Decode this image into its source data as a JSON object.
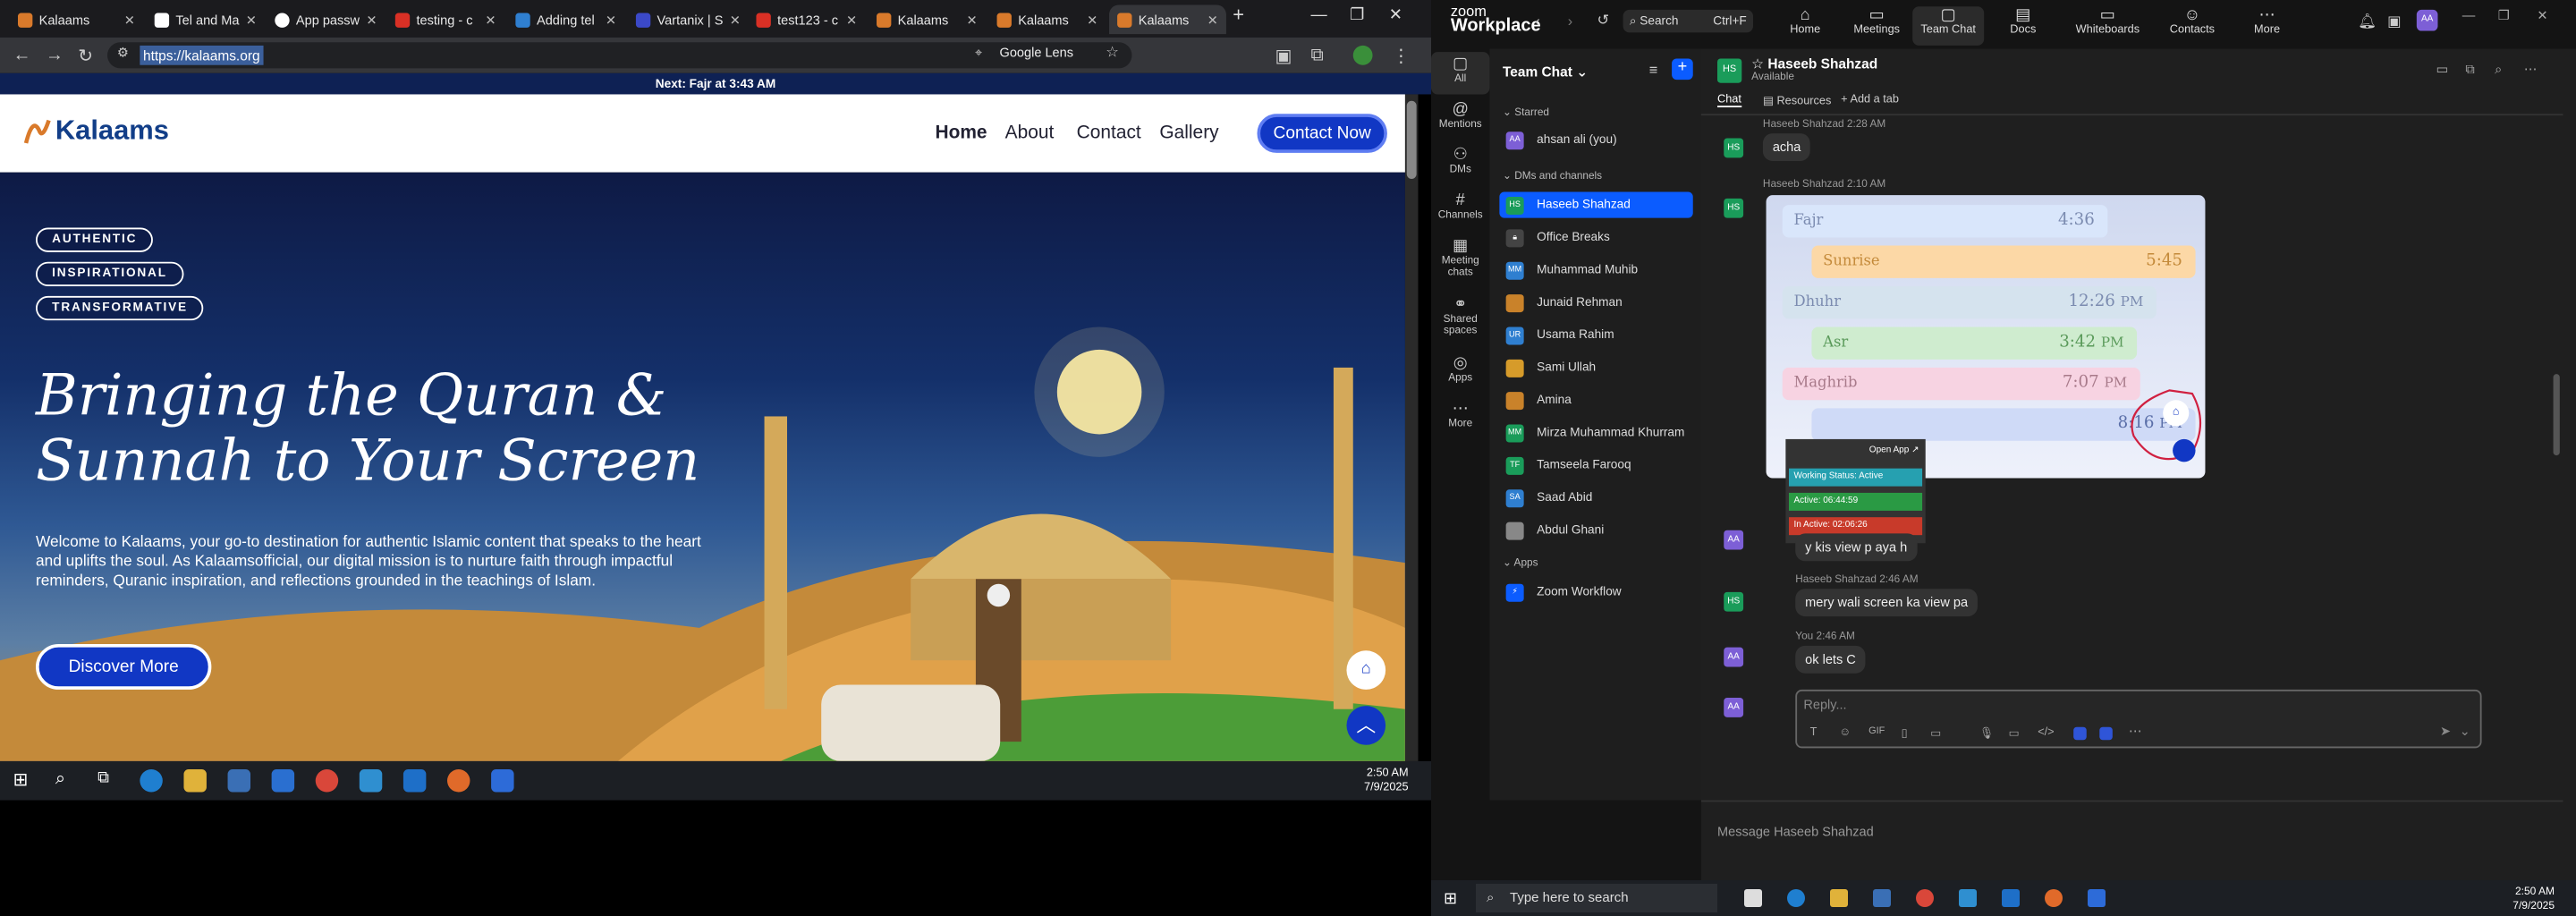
{
  "browser": {
    "tabs": [
      "Kalaams",
      "Tel and Ma",
      "App passw",
      "testing - c",
      "Adding tel",
      "Vartanix | S",
      "test123 - c",
      "Kalaams",
      "Kalaams",
      "Kalaams"
    ],
    "url": "https://kalaams.org",
    "lens_label": "Google Lens"
  },
  "site": {
    "notice": "Next: Fajr at 3:43 AM",
    "logo": "Kalaams",
    "nav": [
      "Home",
      "About",
      "Contact",
      "Gallery"
    ],
    "cta": "Contact Now",
    "pills": [
      "AUTHENTIC",
      "INSPIRATIONAL",
      "TRANSFORMATIVE"
    ],
    "headline": "Bringing the Quran & Sunnah to Your Screen",
    "paragraph": "Welcome to Kalaams, your go-to destination for authentic Islamic content that speaks to the heart and uplifts the soul. As Kalaamsofficial, our digital mission is to nurture faith through impactful reminders, Quranic inspiration, and reflections grounded in the teachings of Islam.",
    "discover": "Discover More"
  },
  "taskbar_left": {
    "time": "2:50 AM",
    "date": "7/9/2025"
  },
  "zoom": {
    "brand_top": "zoom",
    "brand": "Workplace",
    "search": "Search",
    "search_shortcut": "Ctrl+F",
    "tabs": [
      "Home",
      "Meetings",
      "Team Chat",
      "Docs",
      "Whiteboards",
      "Contacts",
      "More"
    ],
    "rail": [
      "All",
      "Mentions",
      "DMs",
      "Channels",
      "Meeting chats",
      "Shared spaces",
      "Apps",
      "More"
    ],
    "panel_title": "Team Chat",
    "sections": {
      "starred": "Starred",
      "dms": "DMs and channels",
      "apps": "Apps"
    },
    "starred": [
      {
        "initials": "AA",
        "name": "ahsan ali (you)",
        "color": "#7d5fd6"
      }
    ],
    "channels": [
      {
        "initials": "HS",
        "name": "Haseeb Shahzad",
        "color": "#1a9c5a",
        "active": true
      },
      {
        "initials": "",
        "name": "Office Breaks",
        "color": "#555"
      },
      {
        "initials": "MM",
        "name": "Muhammad Muhib",
        "color": "#2f7fd0"
      },
      {
        "initials": "",
        "name": "Junaid Rehman",
        "color": "#c9822a"
      },
      {
        "initials": "UR",
        "name": "Usama Rahim",
        "color": "#2f7fd0"
      },
      {
        "initials": "",
        "name": "Sami Ullah",
        "color": "#d69b2a"
      },
      {
        "initials": "",
        "name": "Amina",
        "color": "#c9822a"
      },
      {
        "initials": "MM",
        "name": "Mirza Muhammad Khurram",
        "color": "#1a9c5a"
      },
      {
        "initials": "TF",
        "name": "Tamseela Farooq",
        "color": "#1a9c5a"
      },
      {
        "initials": "SA",
        "name": "Saad Abid",
        "color": "#2f7fd0"
      },
      {
        "initials": "",
        "name": "Abdul Ghani",
        "color": "#888"
      }
    ],
    "apps": [
      {
        "name": "Zoom Workflow"
      }
    ],
    "chat": {
      "name": "Haseeb Shahzad",
      "status": "Available",
      "tabs": [
        "Chat",
        "Resources",
        "Add a tab"
      ],
      "messages": [
        {
          "meta": "Haseeb Shahzad 2:28 AM",
          "text": "acha"
        },
        {
          "meta": "Haseeb Shahzad 2:10 AM",
          "text": ""
        },
        {
          "meta": "",
          "text": "y kis view p aya h"
        },
        {
          "meta": "Haseeb Shahzad 2:46 AM",
          "text": "mery wali screen ka view pa"
        },
        {
          "meta": "You 2:46 AM",
          "text": "ok lets C"
        }
      ],
      "prayer_rows": [
        {
          "name": "Fajr",
          "time": "4:36",
          "color": "#d9e6fb"
        },
        {
          "name": "Sunrise",
          "time": "5:45",
          "color": "#fcd8a6"
        },
        {
          "name": "Dhuhr",
          "time": "12:26",
          "color": "#d5e3ee"
        },
        {
          "name": "Asr",
          "time": "3:42",
          "color": "#cfeccf"
        },
        {
          "name": "Maghrib",
          "time": "7:07",
          "color": "#f7d3e2"
        },
        {
          "name": "",
          "time": "8:16",
          "color": "#cfdaf7"
        }
      ],
      "prayer_suffix": "PM",
      "popup": {
        "open": "Open App",
        "status": "Working Status: Active",
        "active": "Active: 06:44:59",
        "inactive": "In Active: 02:06:26"
      },
      "reply_placeholder": "Reply...",
      "message_placeholder": "Message Haseeb Shahzad"
    }
  },
  "taskbar_right": {
    "search": "Type here to search",
    "time": "2:50 AM",
    "date": "7/9/2025"
  }
}
